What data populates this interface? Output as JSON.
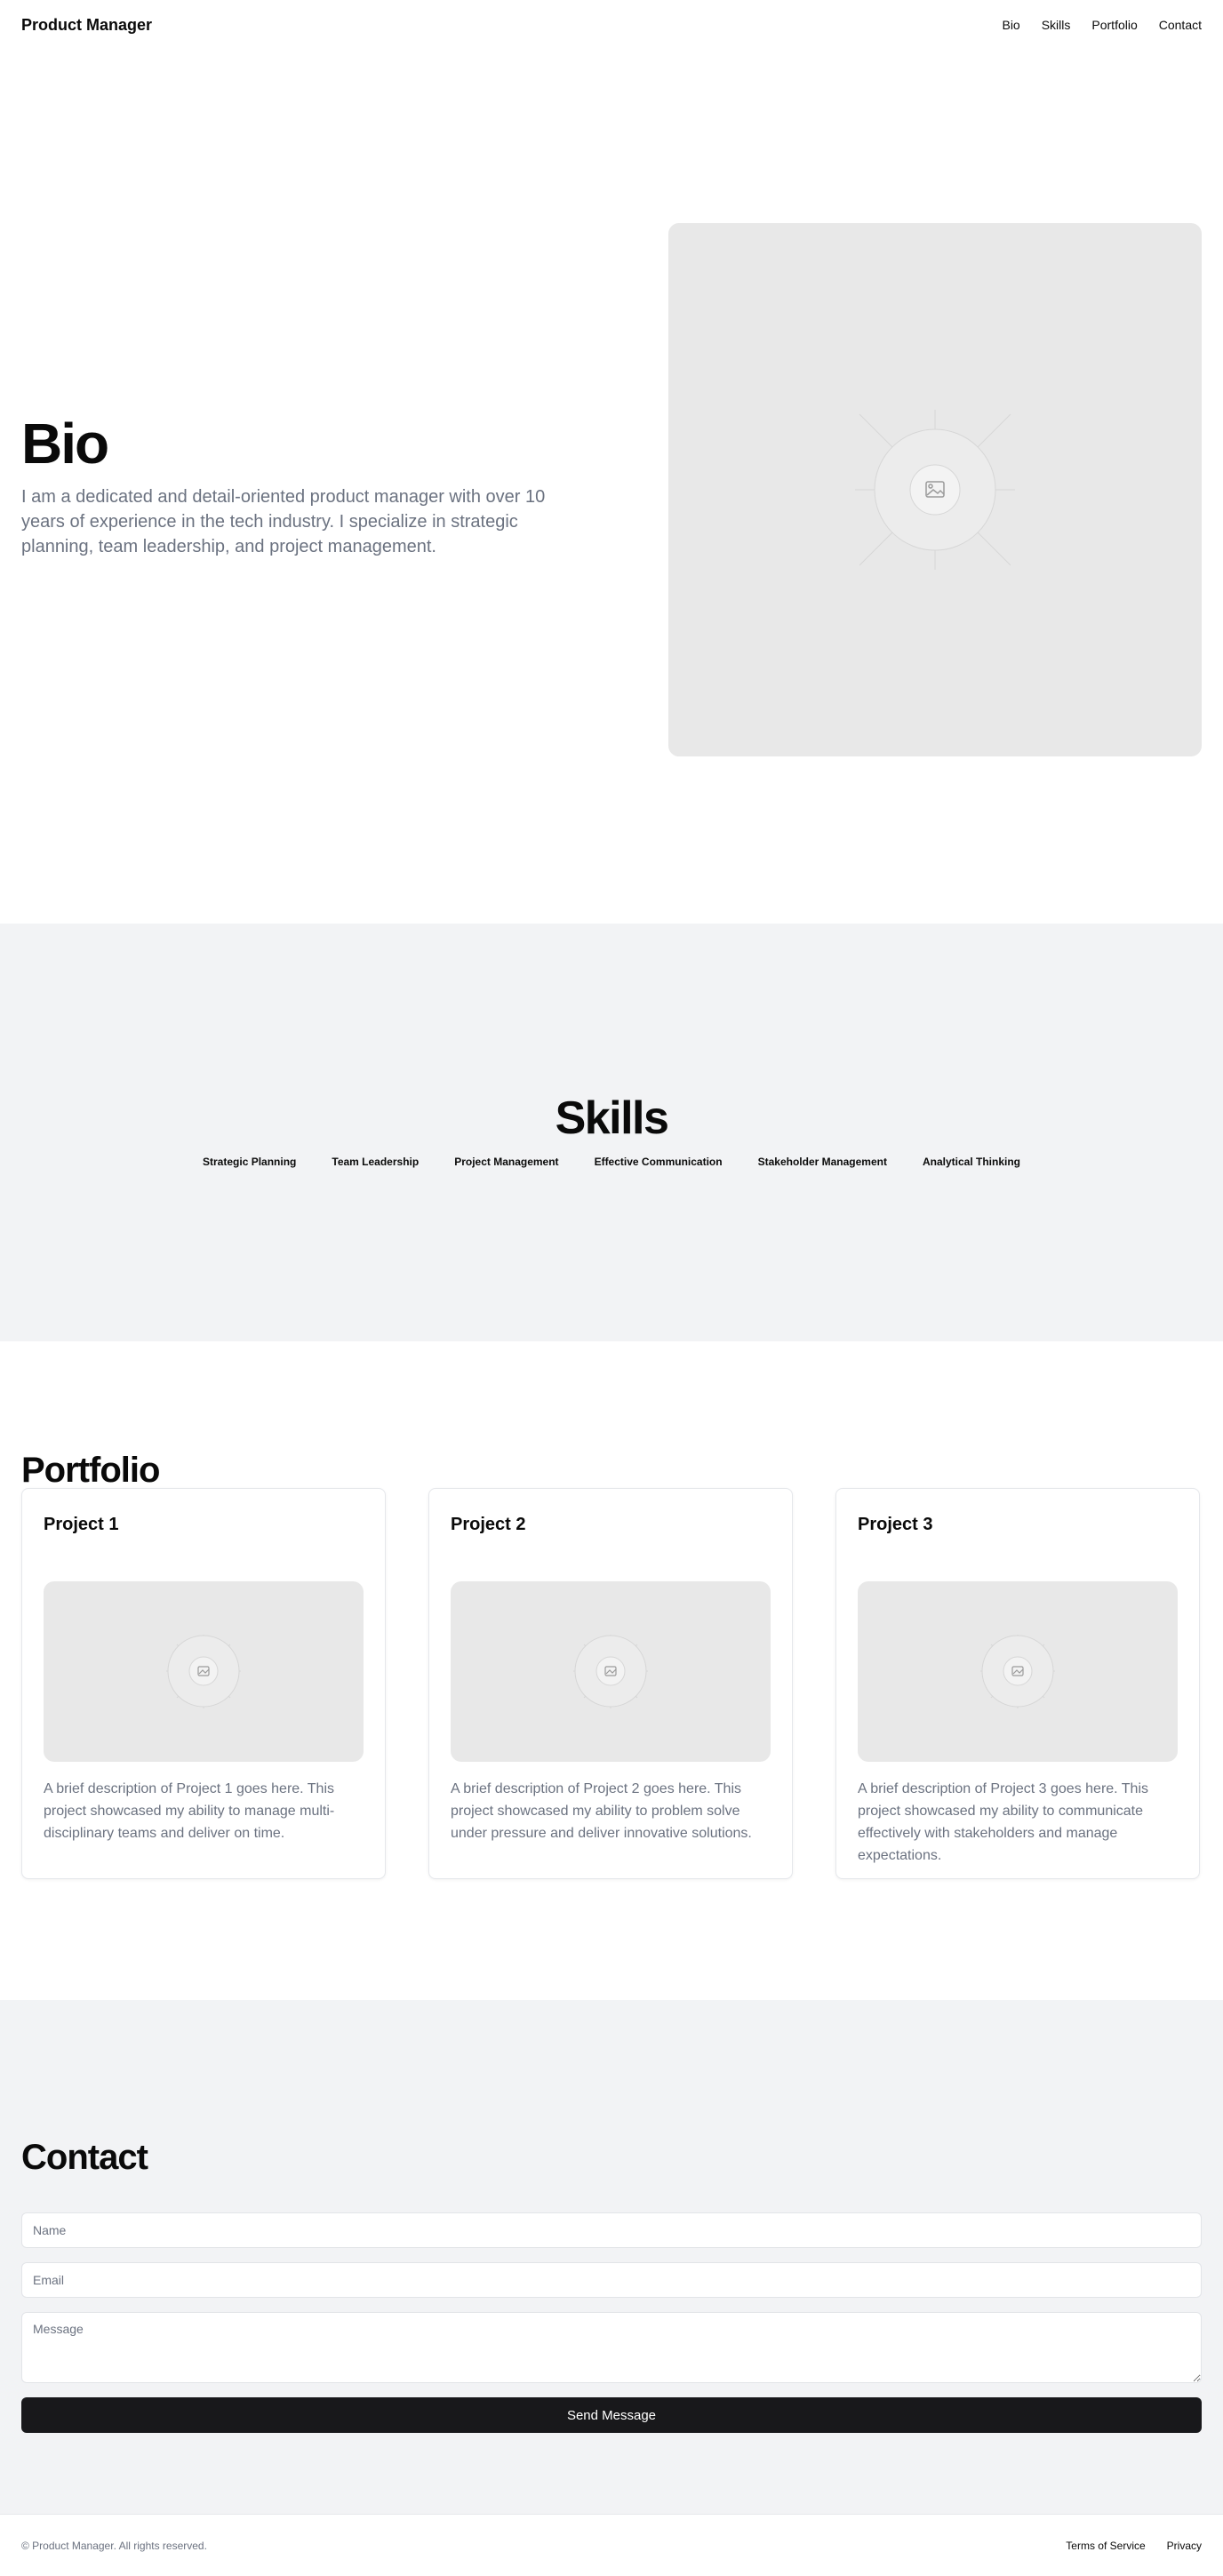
{
  "header": {
    "brand": "Product Manager",
    "nav": [
      "Bio",
      "Skills",
      "Portfolio",
      "Contact"
    ]
  },
  "bio": {
    "title": "Bio",
    "description": "I am a dedicated and detail-oriented product manager with over 10 years of experience in the tech industry. I specialize in strategic planning, team leadership, and project management.",
    "image_icon": "image-placeholder-icon"
  },
  "skills": {
    "title": "Skills",
    "items": [
      "Strategic Planning",
      "Team Leadership",
      "Project Management",
      "Effective Communication",
      "Stakeholder Management",
      "Analytical Thinking"
    ]
  },
  "portfolio": {
    "title": "Portfolio",
    "projects": [
      {
        "title": "Project 1",
        "description": "A brief description of Project 1 goes here. This project showcased my ability to manage multi-disciplinary teams and deliver on time."
      },
      {
        "title": "Project 2",
        "description": "A brief description of Project 2 goes here. This project showcased my ability to problem solve under pressure and deliver innovative solutions."
      },
      {
        "title": "Project 3",
        "description": "A brief description of Project 3 goes here. This project showcased my ability to communicate effectively with stakeholders and manage expectations."
      }
    ]
  },
  "contact": {
    "title": "Contact",
    "name_placeholder": "Name",
    "email_placeholder": "Email",
    "message_placeholder": "Message",
    "submit_label": "Send Message"
  },
  "footer": {
    "copyright": "© Product Manager. All rights reserved.",
    "links": [
      "Terms of Service",
      "Privacy"
    ]
  },
  "colors": {
    "text": "#0a0a0a",
    "muted": "#6b7280",
    "section_bg": "#f2f3f5",
    "placeholder_bg": "#e8e8e8",
    "button_bg": "#18181b"
  }
}
